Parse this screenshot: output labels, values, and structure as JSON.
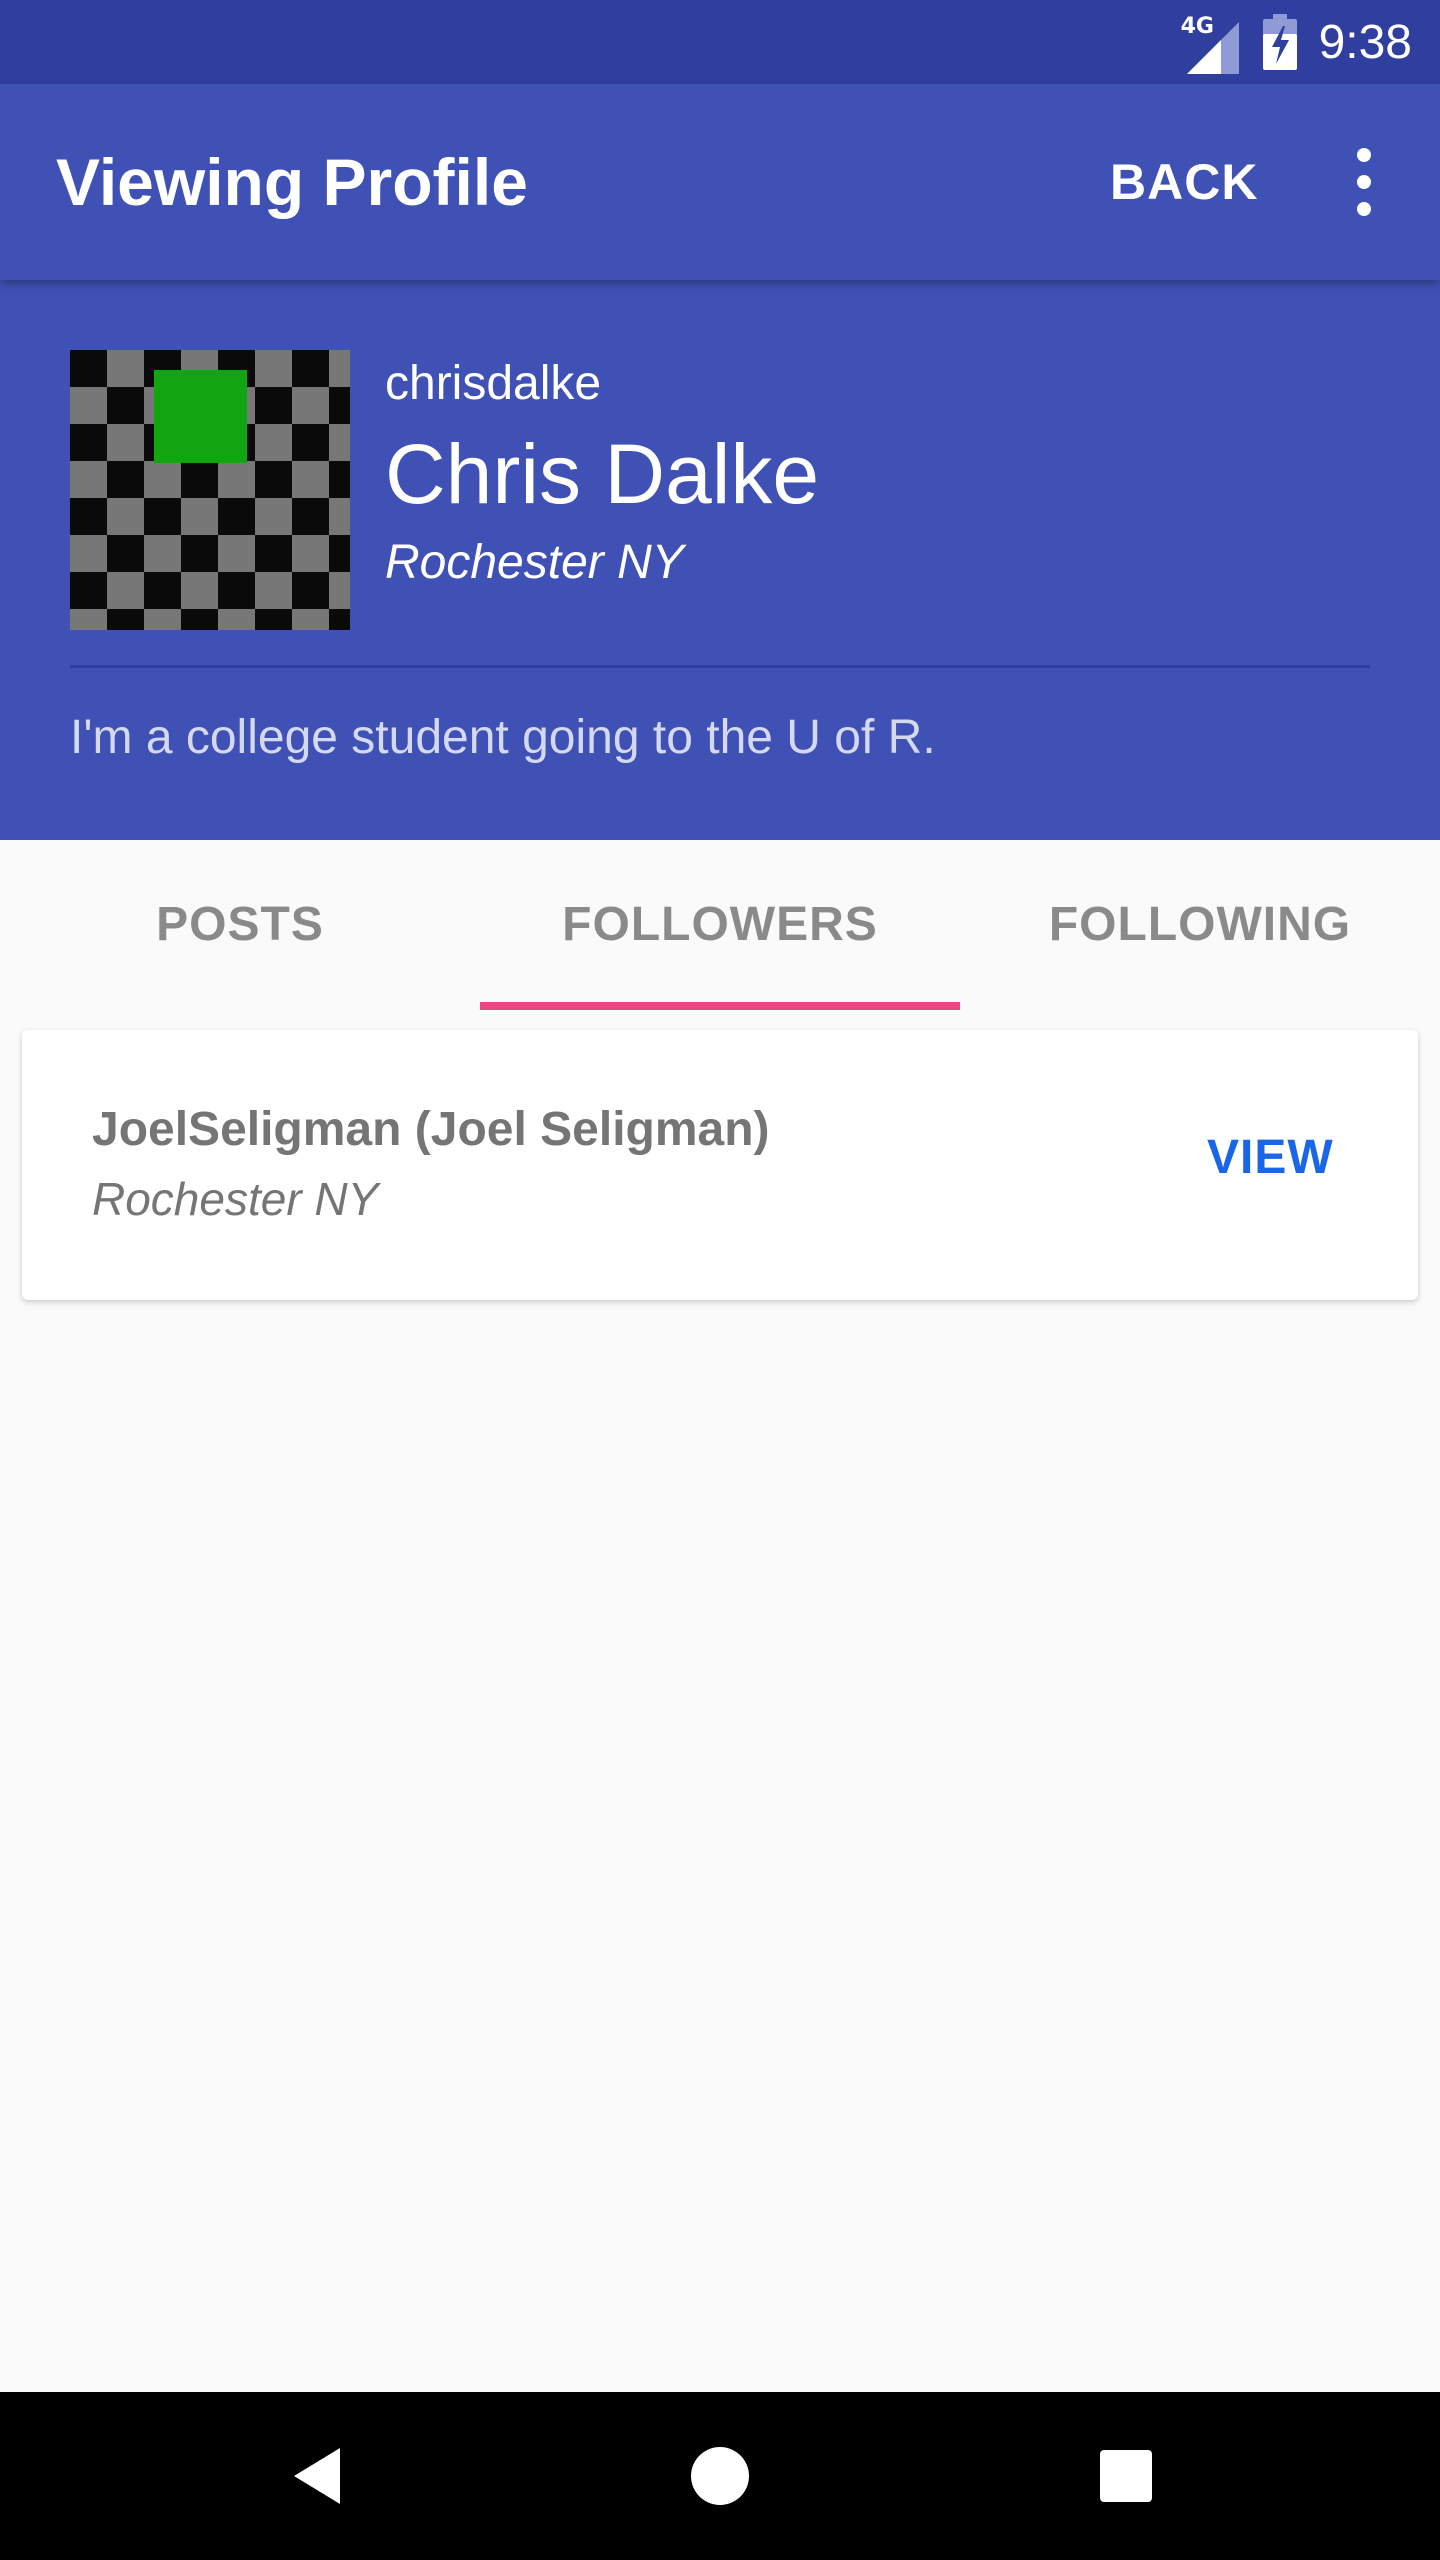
{
  "status_bar": {
    "network_label": "4G",
    "time": "9:38"
  },
  "app_bar": {
    "title": "Viewing Profile",
    "back_label": "BACK"
  },
  "profile": {
    "username": "chrisdalke",
    "full_name": "Chris Dalke",
    "location": "Rochester NY",
    "bio": "I'm a college student going to the U of R."
  },
  "tabs": [
    {
      "label": "POSTS",
      "selected": false
    },
    {
      "label": "FOLLOWERS",
      "selected": true
    },
    {
      "label": "FOLLOWING",
      "selected": false
    }
  ],
  "followers": [
    {
      "name": "JoelSeligman (Joel Seligman)",
      "location": "Rochester NY",
      "action_label": "VIEW"
    }
  ],
  "colors": {
    "primary": "#3f51b5",
    "primary_dark": "#303f9f",
    "tab_indicator": "#e94a81",
    "action": "#1a66e8"
  },
  "icons": {
    "signal": "cell-signal-icon",
    "battery": "battery-charging-icon",
    "overflow": "more-vert-icon",
    "nav_back": "nav-back-icon",
    "nav_home": "nav-home-icon",
    "nav_recents": "nav-recents-icon"
  }
}
